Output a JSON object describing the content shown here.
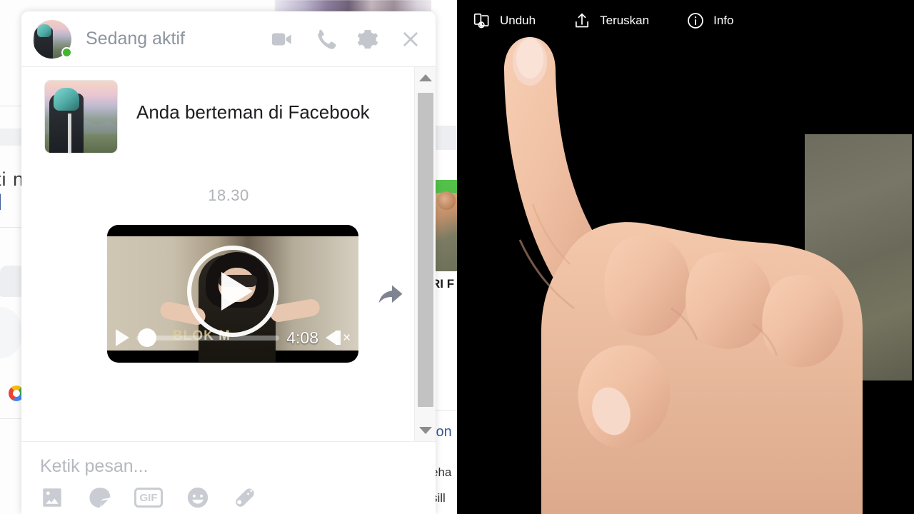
{
  "left_panel": {
    "background_page": {
      "text_fragment_1": "ti n",
      "text_fragment_2": "]",
      "ad_text": "RI F",
      "right_text_1": "ion",
      "right_text_2": "eha",
      "right_text_3": "sill"
    },
    "chat": {
      "status": "Sedang aktif",
      "header_actions": [
        {
          "name": "video-call",
          "icon": "video-camera-icon"
        },
        {
          "name": "voice-call",
          "icon": "phone-icon"
        },
        {
          "name": "settings",
          "icon": "gear-icon"
        },
        {
          "name": "close",
          "icon": "close-icon"
        }
      ],
      "messages": [
        {
          "type": "friend-notice",
          "text": "Anda berteman di Facebook"
        }
      ],
      "timestamp": "18.30",
      "video_message": {
        "duration": "4:08",
        "caption": "BLOK M",
        "play_icon": "play-icon",
        "mute_icon": "speaker-mute-icon",
        "forward_icon": "forward-arrow-icon",
        "reaction_icon": "emoji-reaction-icon"
      },
      "composer": {
        "placeholder": "Ketik pesan...",
        "tools": [
          {
            "name": "photo",
            "icon": "image-icon",
            "label": ""
          },
          {
            "name": "sticker",
            "icon": "sticker-icon",
            "label": ""
          },
          {
            "name": "gif",
            "icon": "gif-icon",
            "label": "GIF"
          },
          {
            "name": "emoji",
            "icon": "smiley-icon",
            "label": ""
          },
          {
            "name": "games",
            "icon": "game-controller-icon",
            "label": ""
          }
        ]
      },
      "scrollbar": {
        "up_icon": "chevron-up-icon",
        "down_icon": "chevron-down-icon"
      }
    }
  },
  "right_panel": {
    "toolbar": [
      {
        "label": "Unduh",
        "icon": "download-cards-icon",
        "highlighted": true
      },
      {
        "label": "Teruskan",
        "icon": "share-upload-icon",
        "highlighted": false
      },
      {
        "label": "Info",
        "icon": "info-circle-icon",
        "highlighted": false
      }
    ],
    "highlight_color": "#ee1111",
    "background_color": "#000000",
    "pointer": "pointing-hand-illustration"
  }
}
